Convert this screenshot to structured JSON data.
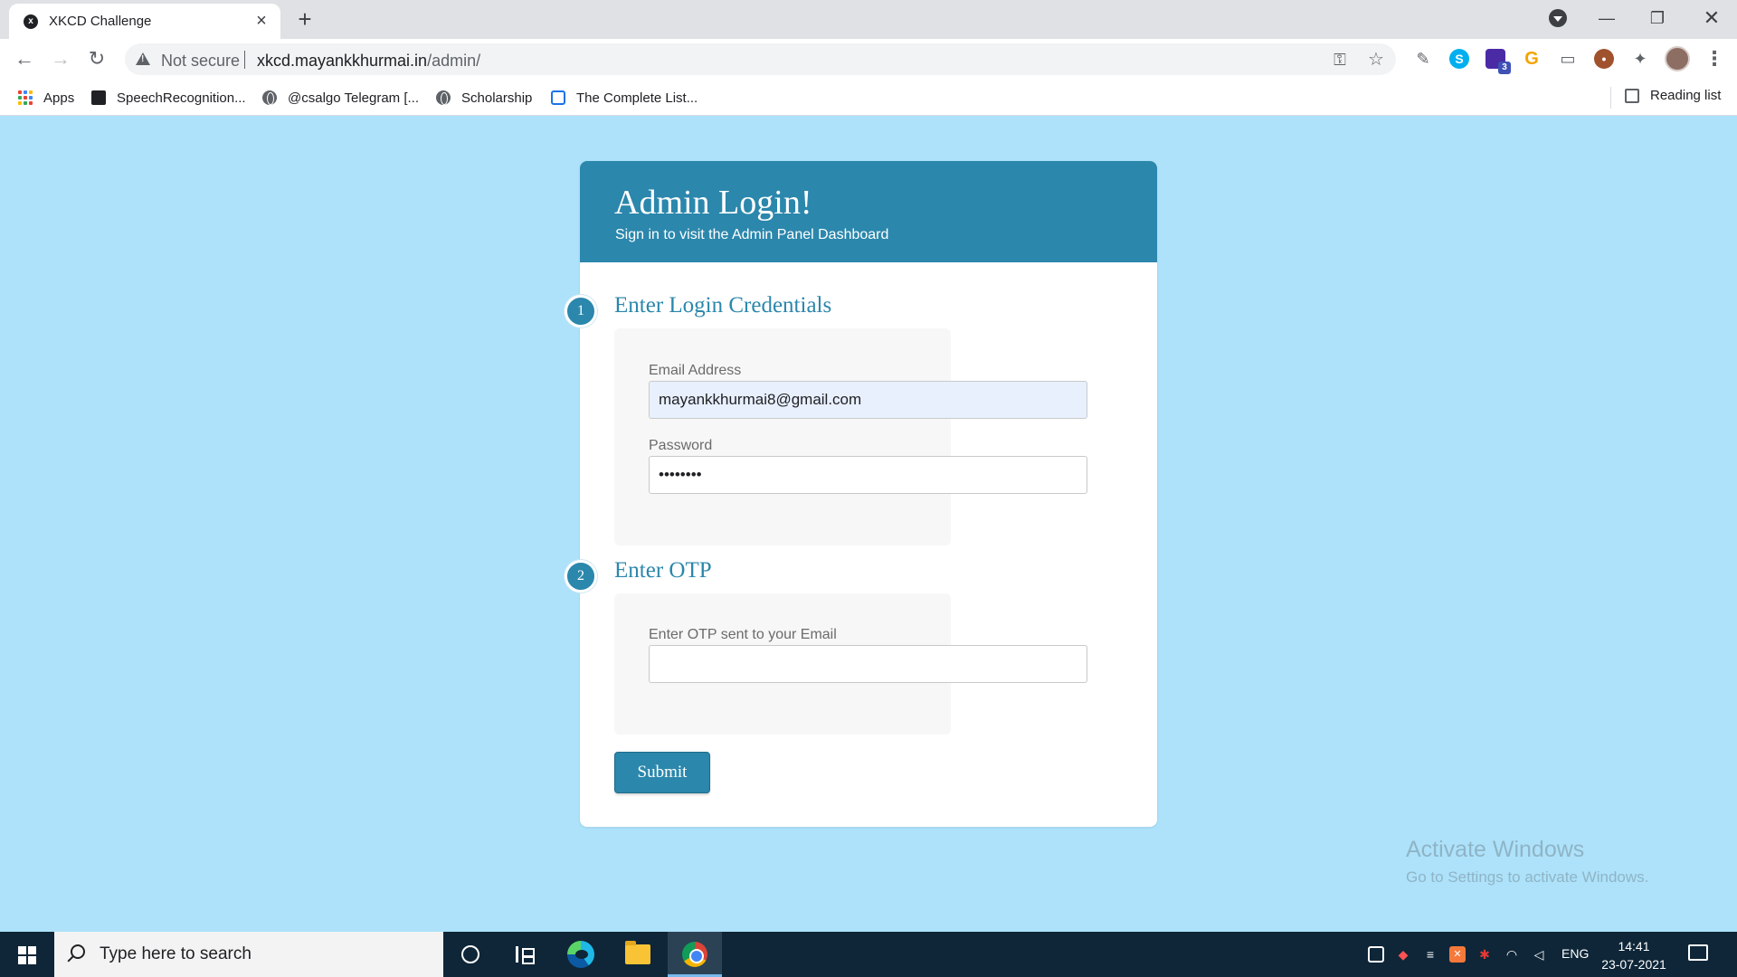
{
  "browser": {
    "tab": {
      "title": "XKCD Challenge",
      "favicon": "xkcd-favicon"
    },
    "address": {
      "security_label": "Not secure",
      "host": "xkcd.mayankkhurmai.in",
      "path": "/admin/"
    },
    "bookmarks": [
      {
        "label": "Apps",
        "icon": "apps-grid-icon"
      },
      {
        "label": "SpeechRecognition...",
        "icon": "speech-favicon"
      },
      {
        "label": "@csalgo Telegram [...",
        "icon": "globe-icon"
      },
      {
        "label": "Scholarship",
        "icon": "globe-icon"
      },
      {
        "label": "The Complete List...",
        "icon": "lock-favicon"
      }
    ],
    "reading_list_label": "Reading list",
    "extension_badge_count": "3"
  },
  "login": {
    "title": "Admin Login!",
    "subtitle": "Sign in to visit the Admin Panel Dashboard",
    "step1": {
      "number": "1",
      "title": "Enter Login Credentials",
      "email_label": "Email Address",
      "email_value": "mayankkhurmai8@gmail.com",
      "password_label": "Password",
      "password_value": "••••••••"
    },
    "step2": {
      "number": "2",
      "title": "Enter OTP",
      "otp_label": "Enter OTP sent to your Email",
      "otp_value": ""
    },
    "submit_label": "Submit"
  },
  "watermark": {
    "title": "Activate Windows",
    "subtitle": "Go to Settings to activate Windows."
  },
  "taskbar": {
    "search_placeholder": "Type here to search",
    "language": "ENG",
    "time": "14:41",
    "date": "23-07-2021"
  },
  "colors": {
    "page_background": "#ade2fa",
    "brand": "#2b87ac",
    "taskbar": "#0e2638"
  }
}
